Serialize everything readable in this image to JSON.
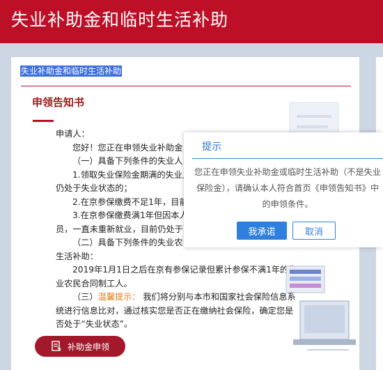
{
  "header": {
    "title": "失业补助金和临时生活补助"
  },
  "breadcrumb": "失业补助金和临时生活补助",
  "section": {
    "title": "申领告知书"
  },
  "notice": {
    "salutation": "申请人：",
    "greeting": "您好！您正在申领失业补助金",
    "cond1_title": "（一）具备下列条件的失业人",
    "cond1_item1a": "1.领取失业保险金期满的失业人",
    "cond1_item1b": "仍处于失业状态的；",
    "cond1_item2": "2.在京参保缴费不足1年，目前",
    "cond1_item3a": "3.在京参保缴费满1年但因本人",
    "cond1_item3b": "员，一直未重新就业，目前仍处于",
    "cond2_title": "（二）具备下列条件的失业农",
    "cond2_title_b": "生活补助：",
    "cond2_text_a": "2019年1月1日之后在京有参保记录但累计参保不满1年的失",
    "cond2_text_b": "业农民合同制工人。",
    "tip_prefix": "（三）",
    "tip_label": "温馨提示：",
    "tip_text_a": "我们将分别与本市和国家社会保险信息系",
    "tip_text_b": "统进行信息比对，通过核实您是否正在缴纳社会保险，确定您是",
    "tip_text_c": "否处于“失业状态”。"
  },
  "apply_button": {
    "label": "补助金申领",
    "icon": "form-icon"
  },
  "dialog": {
    "title": "提示",
    "message": "您正在申领失业补助金或临时生活补助（不是失业保险金），请确认本人符合首页《申领告知书》中的申领条件。",
    "ok_label": "我承诺",
    "cancel_label": "取消"
  },
  "colors": {
    "header_bg": "#bd0f26",
    "accent": "#9b1b1b",
    "button_bg": "#a3192b",
    "dialog_primary": "#2f80dc",
    "warning": "#e07b16",
    "page_bg": "#cdd6e3"
  }
}
